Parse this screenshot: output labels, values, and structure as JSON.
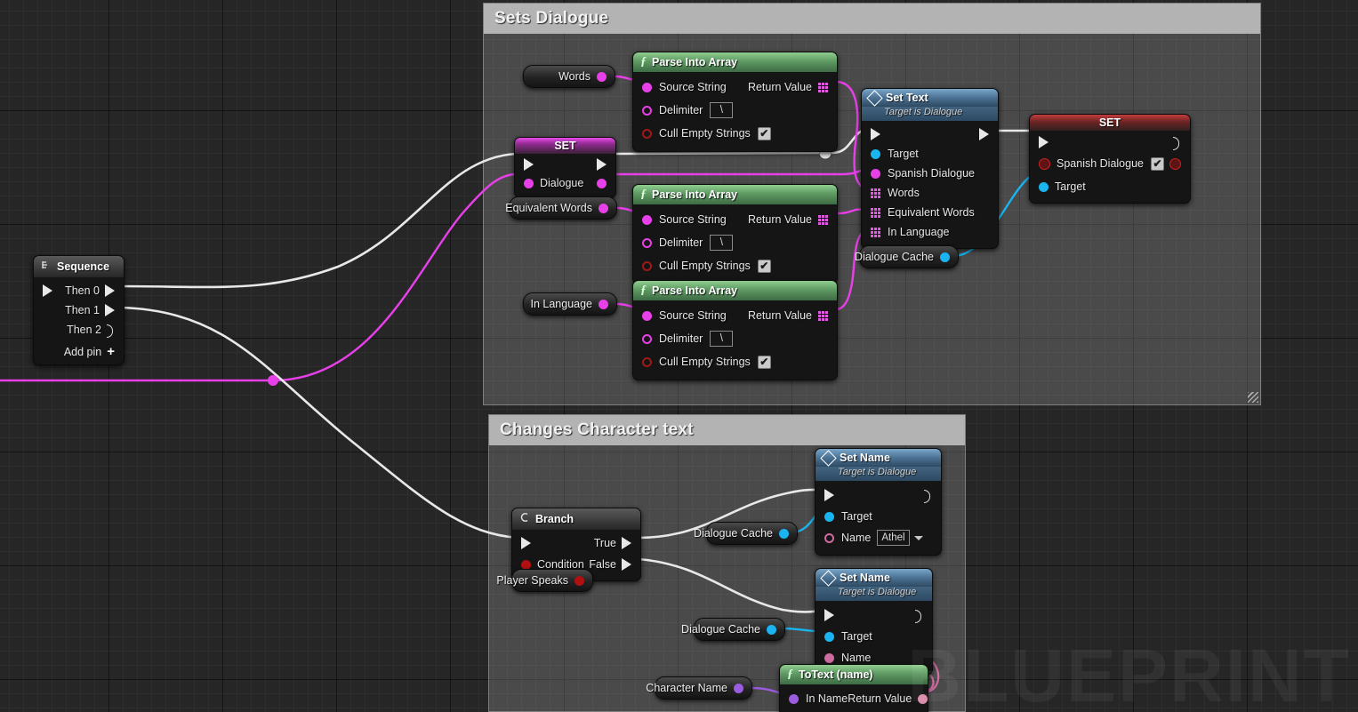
{
  "app": {
    "watermark": "BLUEPRINT"
  },
  "comments": [
    {
      "title": "Sets Dialogue"
    },
    {
      "title": "Changes Character text"
    }
  ],
  "colors": {
    "exec_white": "#e8e8e8",
    "string_magenta": "#e840e8",
    "object_blue": "#1ab4f0",
    "bool_red": "#a01818",
    "name_pink": "#cf6ba0",
    "text_pink": "#d98aa8",
    "comment_bar": "#b3b3b3"
  },
  "nodes": {
    "sequence": {
      "title": "Sequence",
      "pins": [
        "Then 0",
        "Then 1",
        "Then 2"
      ],
      "add_pin": "Add pin"
    },
    "set_dialogue": {
      "title": "SET",
      "pin": "Dialogue"
    },
    "words_var": {
      "label": "Words"
    },
    "equivalent_words_var": {
      "label": "Equivalent Words"
    },
    "in_language_var": {
      "label": "In Language"
    },
    "parse1": {
      "title": "Parse Into Array",
      "inputs": [
        "Source String",
        "Delimiter",
        "Cull Empty Strings"
      ],
      "delimiter_value": "\\",
      "cull_checked": "✔",
      "output": "Return Value"
    },
    "parse2": {
      "title": "Parse Into Array",
      "inputs": [
        "Source String",
        "Delimiter",
        "Cull Empty Strings"
      ],
      "delimiter_value": "\\",
      "cull_checked": "✔",
      "output": "Return Value"
    },
    "parse3": {
      "title": "Parse Into Array",
      "inputs": [
        "Source String",
        "Delimiter",
        "Cull Empty Strings"
      ],
      "delimiter_value": "\\",
      "cull_checked": "✔",
      "output": "Return Value"
    },
    "set_text": {
      "title": "Set Text",
      "subtitle": "Target is Dialogue",
      "inputs": [
        "Target",
        "Spanish Dialogue",
        "Words",
        "Equivalent Words",
        "In Language"
      ]
    },
    "dialogue_cache_1": {
      "label": "Dialogue Cache"
    },
    "set_spanish": {
      "title": "SET",
      "pin": "Spanish Dialogue",
      "checked": "✔",
      "target": "Target"
    },
    "branch": {
      "title": "Branch",
      "condition": "Condition",
      "true_label": "True",
      "false_label": "False"
    },
    "player_speaks_var": {
      "label": "Player Speaks"
    },
    "dialogue_cache_2": {
      "label": "Dialogue Cache"
    },
    "dialogue_cache_3": {
      "label": "Dialogue Cache"
    },
    "set_name_1": {
      "title": "Set Name",
      "subtitle": "Target is Dialogue",
      "target": "Target",
      "name_label": "Name",
      "name_value": "Athel"
    },
    "set_name_2": {
      "title": "Set Name",
      "subtitle": "Target is Dialogue",
      "target": "Target",
      "name_label": "Name"
    },
    "character_name_var": {
      "label": "Character Name"
    },
    "to_text": {
      "title": "ToText (name)",
      "input": "In Name",
      "output": "Return Value"
    }
  }
}
